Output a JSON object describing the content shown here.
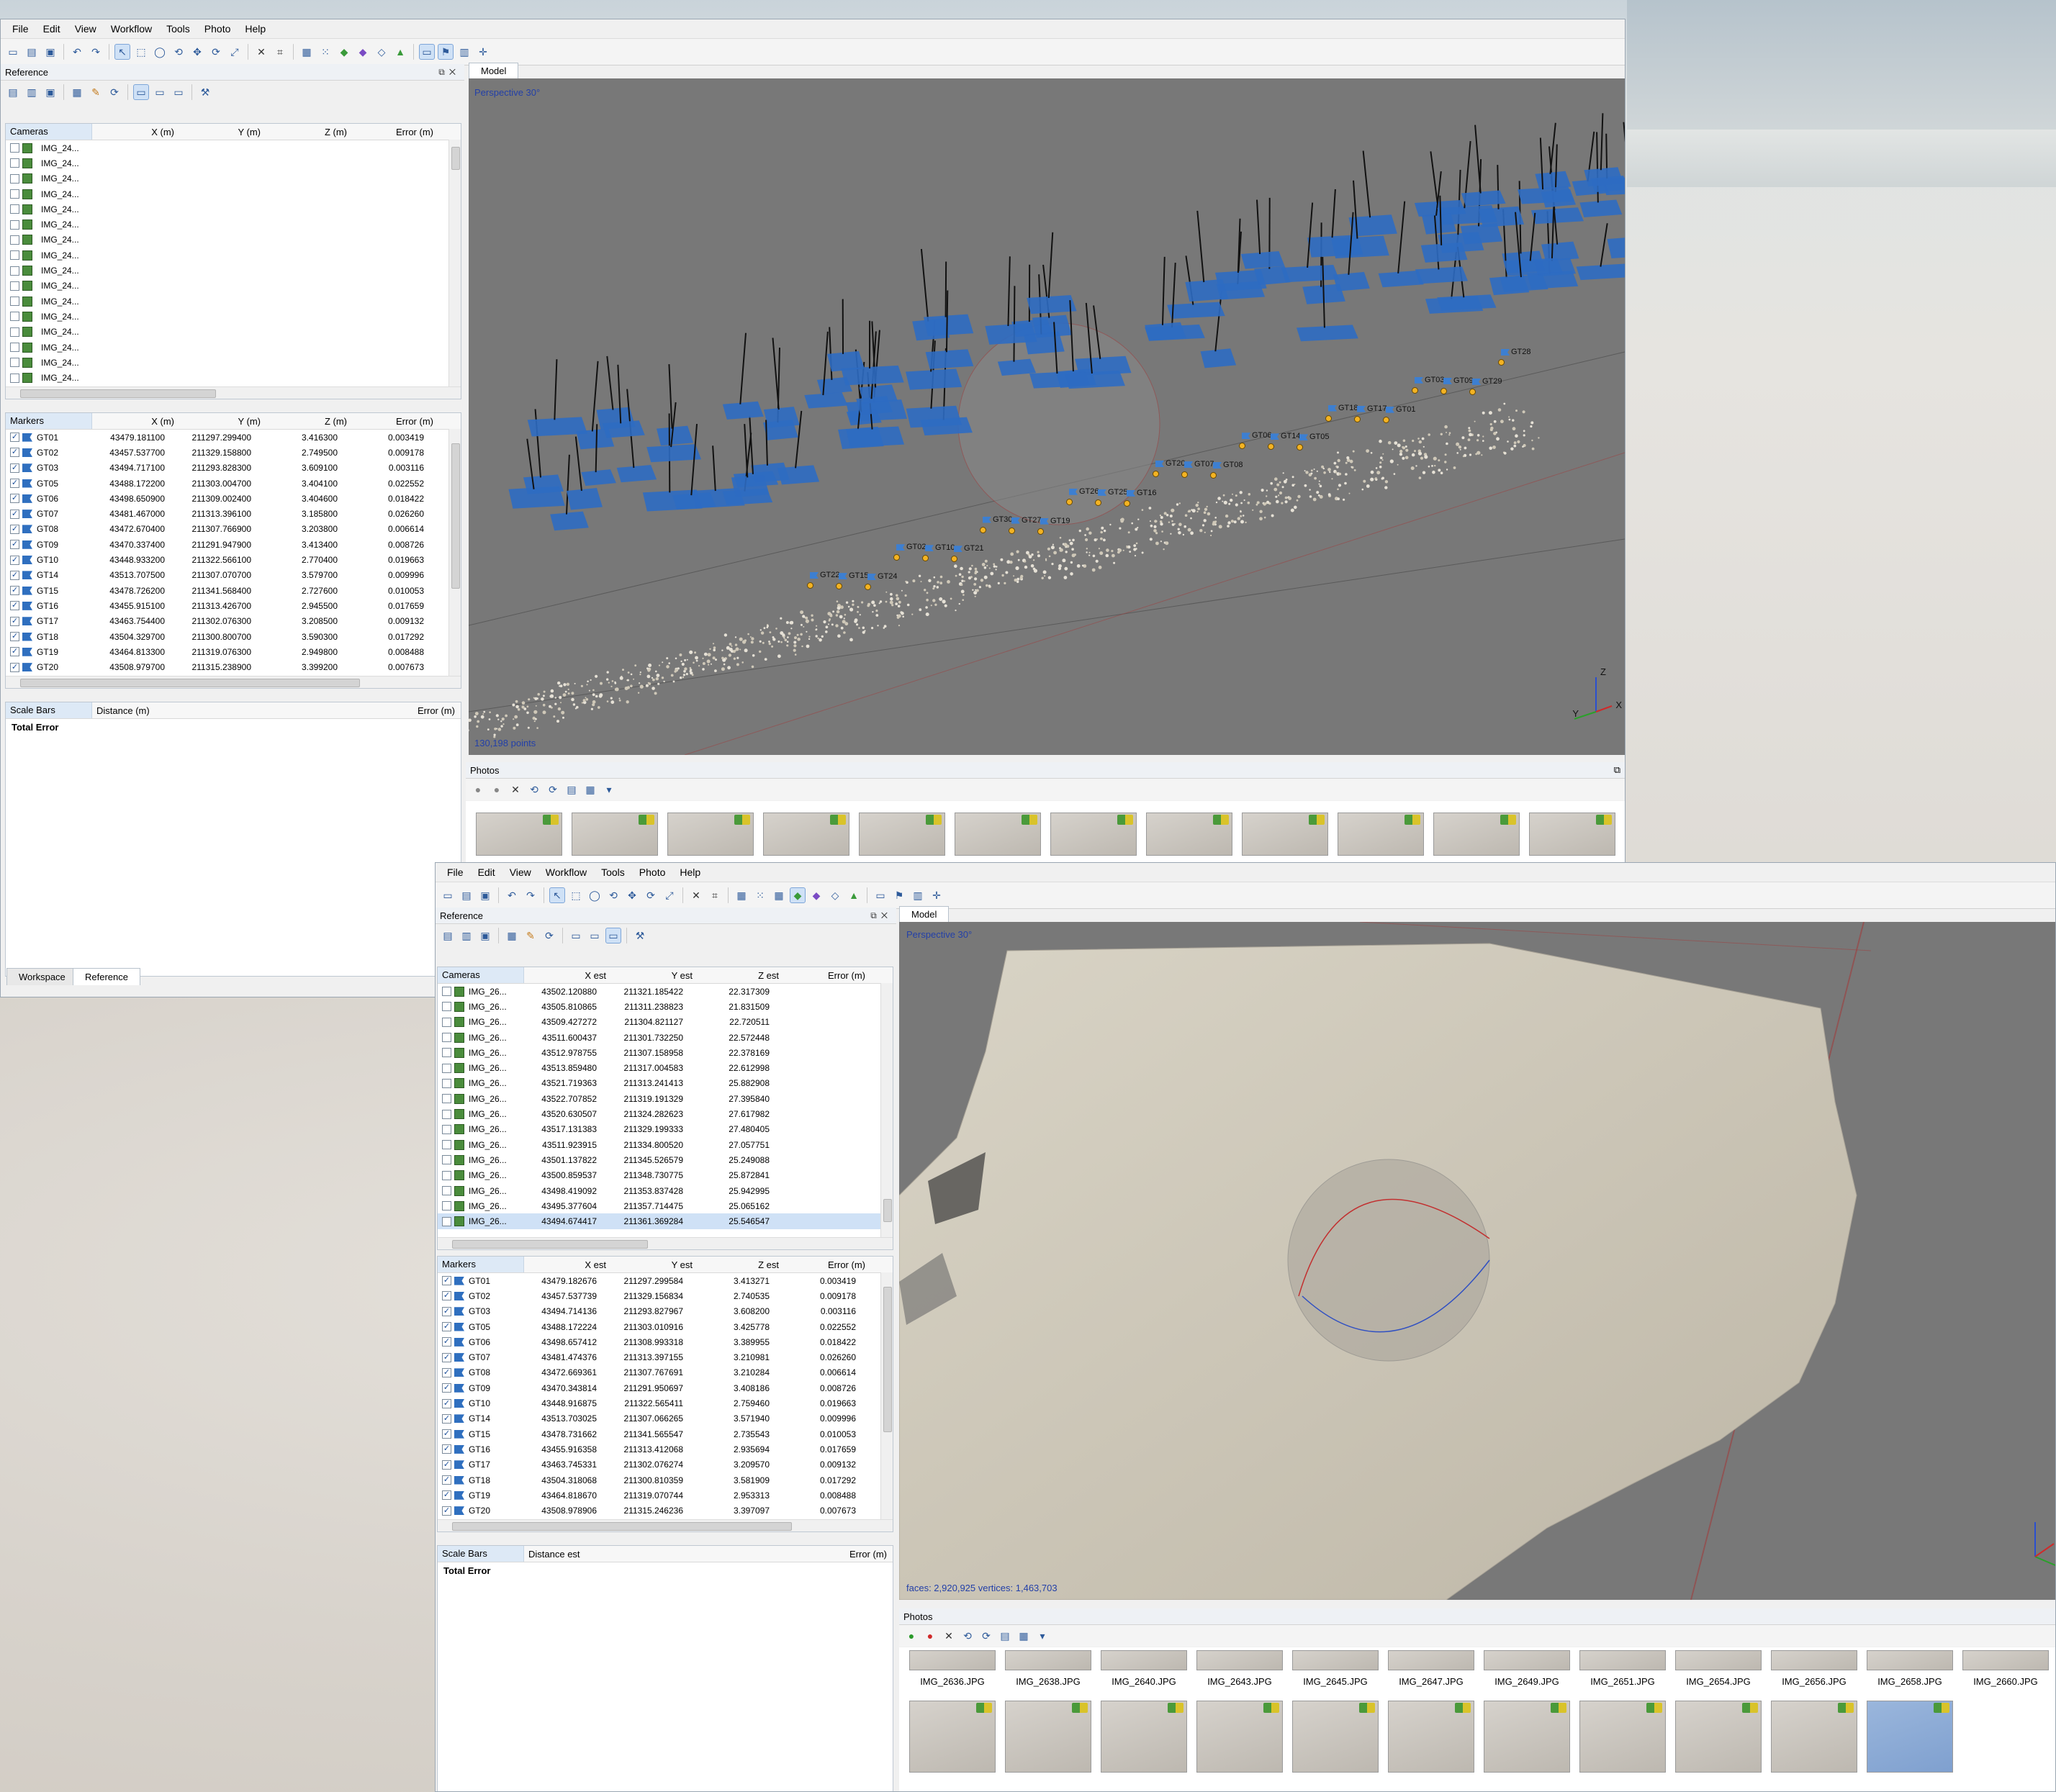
{
  "menu": [
    "File",
    "Edit",
    "View",
    "Workflow",
    "Tools",
    "Photo",
    "Help"
  ],
  "win1": {
    "reference_title": "Reference",
    "model_tab": "Model",
    "viewport_label": "Perspective 30°",
    "points_label": "130,198 points",
    "photos_title": "Photos",
    "tabs": {
      "workspace": "Workspace",
      "reference": "Reference"
    },
    "cameras_header": [
      "Cameras",
      "X (m)",
      "Y (m)",
      "Z (m)",
      "Error (m)"
    ],
    "cameras": [
      "IMG_24...",
      "IMG_24...",
      "IMG_24...",
      "IMG_24...",
      "IMG_24...",
      "IMG_24...",
      "IMG_24...",
      "IMG_24...",
      "IMG_24...",
      "IMG_24...",
      "IMG_24...",
      "IMG_24...",
      "IMG_24...",
      "IMG_24...",
      "IMG_24...",
      "IMG_24..."
    ],
    "markers_header": [
      "Markers",
      "X (m)",
      "Y (m)",
      "Z (m)",
      "Error (m)"
    ],
    "markers": [
      [
        "GT01",
        "43479.181100",
        "211297.299400",
        "3.416300",
        "0.003419"
      ],
      [
        "GT02",
        "43457.537700",
        "211329.158800",
        "2.749500",
        "0.009178"
      ],
      [
        "GT03",
        "43494.717100",
        "211293.828300",
        "3.609100",
        "0.003116"
      ],
      [
        "GT05",
        "43488.172200",
        "211303.004700",
        "3.404100",
        "0.022552"
      ],
      [
        "GT06",
        "43498.650900",
        "211309.002400",
        "3.404600",
        "0.018422"
      ],
      [
        "GT07",
        "43481.467000",
        "211313.396100",
        "3.185800",
        "0.026260"
      ],
      [
        "GT08",
        "43472.670400",
        "211307.766900",
        "3.203800",
        "0.006614"
      ],
      [
        "GT09",
        "43470.337400",
        "211291.947900",
        "3.413400",
        "0.008726"
      ],
      [
        "GT10",
        "43448.933200",
        "211322.566100",
        "2.770400",
        "0.019663"
      ],
      [
        "GT14",
        "43513.707500",
        "211307.070700",
        "3.579700",
        "0.009996"
      ],
      [
        "GT15",
        "43478.726200",
        "211341.568400",
        "2.727600",
        "0.010053"
      ],
      [
        "GT16",
        "43455.915100",
        "211313.426700",
        "2.945500",
        "0.017659"
      ],
      [
        "GT17",
        "43463.754400",
        "211302.076300",
        "3.208500",
        "0.009132"
      ],
      [
        "GT18",
        "43504.329700",
        "211300.800700",
        "3.590300",
        "0.017292"
      ],
      [
        "GT19",
        "43464.813300",
        "211319.076300",
        "2.949800",
        "0.008488"
      ],
      [
        "GT20",
        "43508.979700",
        "211315.238900",
        "3.399200",
        "0.007673"
      ]
    ],
    "scalebars_header": [
      "Scale Bars",
      "Distance (m)",
      "Error (m)"
    ],
    "total_error": "Total Error",
    "axis": {
      "z": "Z",
      "y": "Y",
      "x": "X"
    }
  },
  "win2": {
    "reference_title": "Reference",
    "model_tab": "Model",
    "viewport_label": "Perspective 30°",
    "faces_label": "faces: 2,920,925 vertices: 1,463,703",
    "photos_title": "Photos",
    "cameras_header": [
      "Cameras",
      "X est",
      "Y est",
      "Z est",
      "Error (m)"
    ],
    "cameras": [
      [
        "IMG_26...",
        "43502.120880",
        "211321.185422",
        "22.317309"
      ],
      [
        "IMG_26...",
        "43505.810865",
        "211311.238823",
        "21.831509"
      ],
      [
        "IMG_26...",
        "43509.427272",
        "211304.821127",
        "22.720511"
      ],
      [
        "IMG_26...",
        "43511.600437",
        "211301.732250",
        "22.572448"
      ],
      [
        "IMG_26...",
        "43512.978755",
        "211307.158958",
        "22.378169"
      ],
      [
        "IMG_26...",
        "43513.859480",
        "211317.004583",
        "22.612998"
      ],
      [
        "IMG_26...",
        "43521.719363",
        "211313.241413",
        "25.882908"
      ],
      [
        "IMG_26...",
        "43522.707852",
        "211319.191329",
        "27.395840"
      ],
      [
        "IMG_26...",
        "43520.630507",
        "211324.282623",
        "27.617982"
      ],
      [
        "IMG_26...",
        "43517.131383",
        "211329.199333",
        "27.480405"
      ],
      [
        "IMG_26...",
        "43511.923915",
        "211334.800520",
        "27.057751"
      ],
      [
        "IMG_26...",
        "43501.137822",
        "211345.526579",
        "25.249088"
      ],
      [
        "IMG_26...",
        "43500.859537",
        "211348.730775",
        "25.872841"
      ],
      [
        "IMG_26...",
        "43498.419092",
        "211353.837428",
        "25.942995"
      ],
      [
        "IMG_26...",
        "43495.377604",
        "211357.714475",
        "25.065162"
      ],
      [
        "IMG_26...",
        "43494.674417",
        "211361.369284",
        "25.546547"
      ]
    ],
    "markers_header": [
      "Markers",
      "X est",
      "Y est",
      "Z est",
      "Error (m)"
    ],
    "markers": [
      [
        "GT01",
        "43479.182676",
        "211297.299584",
        "3.413271",
        "0.003419"
      ],
      [
        "GT02",
        "43457.537739",
        "211329.156834",
        "2.740535",
        "0.009178"
      ],
      [
        "GT03",
        "43494.714136",
        "211293.827967",
        "3.608200",
        "0.003116"
      ],
      [
        "GT05",
        "43488.172224",
        "211303.010916",
        "3.425778",
        "0.022552"
      ],
      [
        "GT06",
        "43498.657412",
        "211308.993318",
        "3.389955",
        "0.018422"
      ],
      [
        "GT07",
        "43481.474376",
        "211313.397155",
        "3.210981",
        "0.026260"
      ],
      [
        "GT08",
        "43472.669361",
        "211307.767691",
        "3.210284",
        "0.006614"
      ],
      [
        "GT09",
        "43470.343814",
        "211291.950697",
        "3.408186",
        "0.008726"
      ],
      [
        "GT10",
        "43448.916875",
        "211322.565411",
        "2.759460",
        "0.019663"
      ],
      [
        "GT14",
        "43513.703025",
        "211307.066265",
        "3.571940",
        "0.009996"
      ],
      [
        "GT15",
        "43478.731662",
        "211341.565547",
        "2.735543",
        "0.010053"
      ],
      [
        "GT16",
        "43455.916358",
        "211313.412068",
        "2.935694",
        "0.017659"
      ],
      [
        "GT17",
        "43463.745331",
        "211302.076274",
        "3.209570",
        "0.009132"
      ],
      [
        "GT18",
        "43504.318068",
        "211300.810359",
        "3.581909",
        "0.017292"
      ],
      [
        "GT19",
        "43464.818670",
        "211319.070744",
        "2.953313",
        "0.008488"
      ],
      [
        "GT20",
        "43508.978906",
        "211315.246236",
        "3.397097",
        "0.007673"
      ]
    ],
    "scalebars_header": [
      "Scale Bars",
      "Distance est",
      "Error (m)"
    ],
    "total_error": "Total Error",
    "photo_row1": [
      "IMG_2636.JPG",
      "IMG_2638.JPG",
      "IMG_2640.JPG",
      "IMG_2643.JPG",
      "IMG_2645.JPG",
      "IMG_2647.JPG",
      "IMG_2649.JPG",
      "IMG_2651.JPG",
      "IMG_2654.JPG",
      "IMG_2656.JPG",
      "IMG_2658.JPG",
      "IMG_2660.JPG"
    ]
  },
  "markers3d": [
    "GT22",
    "GT15",
    "GT24",
    "GT02",
    "GT10",
    "GT21",
    "GT30",
    "GT27",
    "GT19",
    "GT26",
    "GT25",
    "GT16",
    "GT20",
    "GT07",
    "GT08",
    "GT06",
    "GT14",
    "GT05",
    "GT18",
    "GT17",
    "GT01",
    "GT03",
    "GT09",
    "GT29",
    "GT28"
  ]
}
